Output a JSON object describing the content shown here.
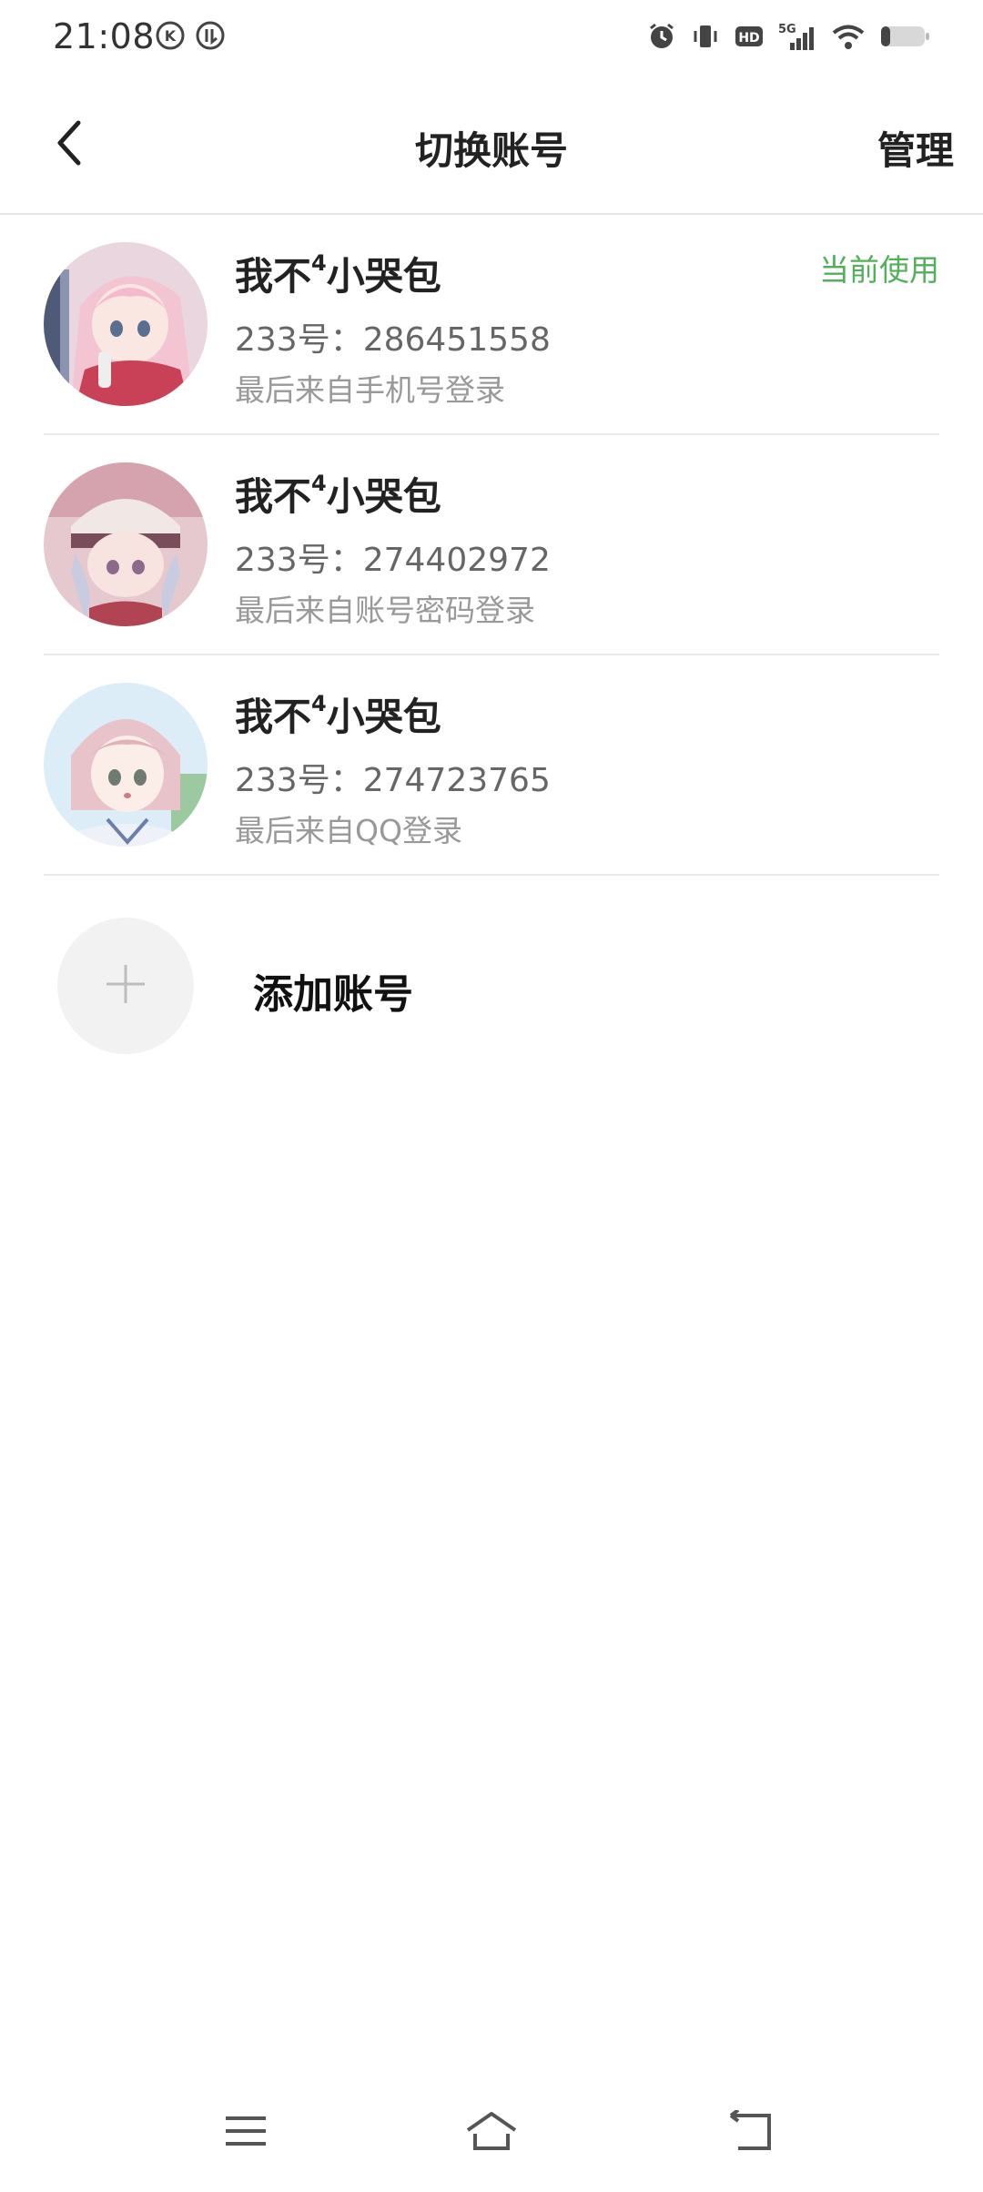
{
  "status_bar": {
    "time": "21:08",
    "left_icons": [
      "k-circle-icon",
      "ll-circle-icon"
    ],
    "right_icons": [
      "alarm-icon",
      "vibrate-icon",
      "hd-icon",
      "5g-signal-icon",
      "wifi-icon",
      "battery-icon"
    ],
    "network_label": "5G",
    "hd_label": "HD"
  },
  "header": {
    "back_icon": "chevron-left-icon",
    "title": "切换账号",
    "manage_label": "管理"
  },
  "accounts": [
    {
      "name": "我不",
      "name_sup": "4",
      "name_suffix": "小哭包",
      "id_line": "233号：286451558",
      "login_line": "最后来自手机号登录",
      "badge": "当前使用"
    },
    {
      "name": "我不",
      "name_sup": "4",
      "name_suffix": "小哭包",
      "id_line": "233号：274402972",
      "login_line": "最后来自账号密码登录"
    },
    {
      "name": "我不",
      "name_sup": "4",
      "name_suffix": "小哭包",
      "id_line": "233号：274723765",
      "login_line": "最后来自QQ登录"
    }
  ],
  "add_account": {
    "icon": "plus-icon",
    "label": "添加账号"
  },
  "colors": {
    "accent_green": "#52b05a",
    "divider": "#ebebeb",
    "add_circle_bg": "#f2f2f2"
  },
  "nav_bar": {
    "icons": [
      "menu-icon",
      "home-icon",
      "back-icon"
    ]
  }
}
